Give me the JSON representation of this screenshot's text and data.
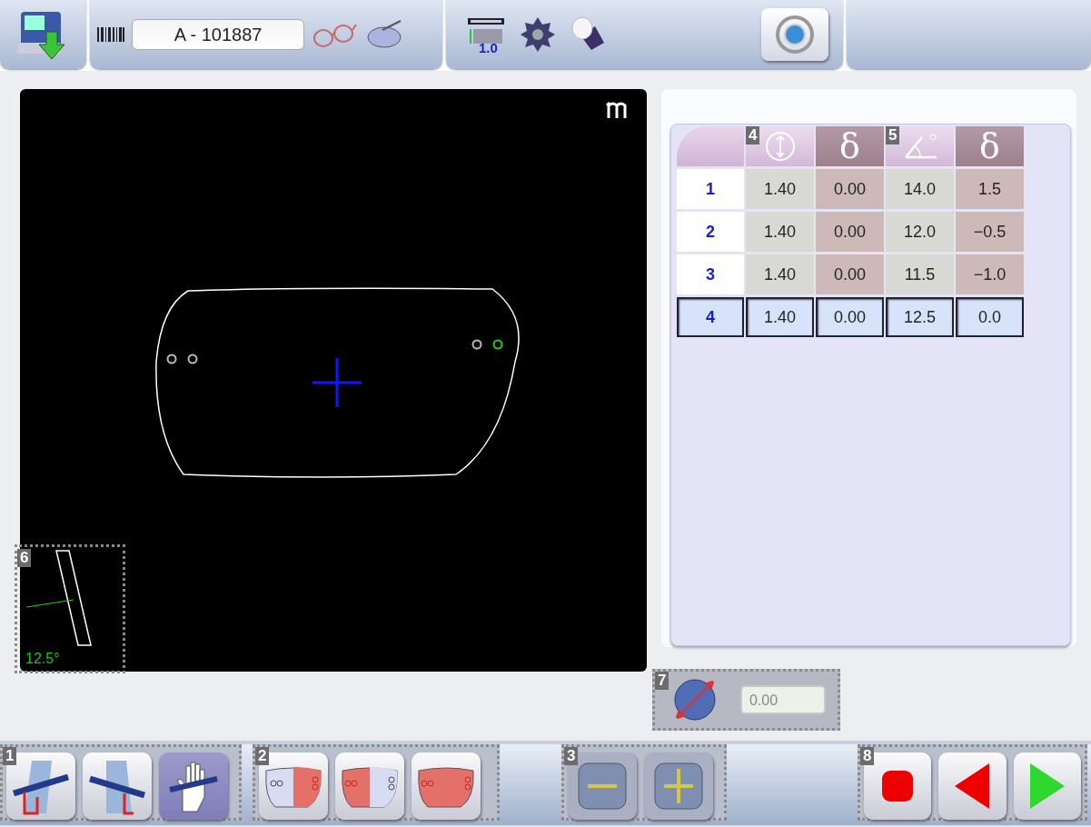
{
  "job_number": "A - 101887",
  "scale_value": "1.0",
  "shape_view": {
    "inset_badge": "6",
    "tilt_angle": "12.5°"
  },
  "table": {
    "header_groups": [
      {
        "badge": "4",
        "delta_symbol": "δ"
      },
      {
        "badge": "5",
        "delta_symbol": "δ"
      }
    ],
    "rows": [
      {
        "label": "1",
        "values": [
          "1.40",
          "0.00",
          "14.0",
          "1.5"
        ],
        "selected": false
      },
      {
        "label": "2",
        "values": [
          "1.40",
          "0.00",
          "12.0",
          "−0.5"
        ],
        "selected": false
      },
      {
        "label": "3",
        "values": [
          "1.40",
          "0.00",
          "11.5",
          "−1.0"
        ],
        "selected": false
      },
      {
        "label": "4",
        "values": [
          "1.40",
          "0.00",
          "12.5",
          "0.0"
        ],
        "selected": true
      }
    ]
  },
  "offset_control": {
    "badge": "7",
    "value": "0.00"
  },
  "bottom_groups": [
    {
      "badge": "1",
      "buttons": [
        {
          "kind": "tilt-left",
          "selected": false
        },
        {
          "kind": "tilt-right",
          "selected": false
        },
        {
          "kind": "hand",
          "selected": true
        }
      ]
    },
    {
      "badge": "2",
      "buttons": [
        {
          "kind": "lens-left"
        },
        {
          "kind": "lens-right"
        },
        {
          "kind": "lens-both"
        }
      ]
    },
    {
      "badge": "3",
      "buttons": [
        {
          "kind": "minus"
        },
        {
          "kind": "plus"
        }
      ]
    },
    {
      "badge": "8",
      "buttons": [
        {
          "kind": "stop"
        },
        {
          "kind": "back"
        },
        {
          "kind": "next"
        }
      ]
    }
  ]
}
